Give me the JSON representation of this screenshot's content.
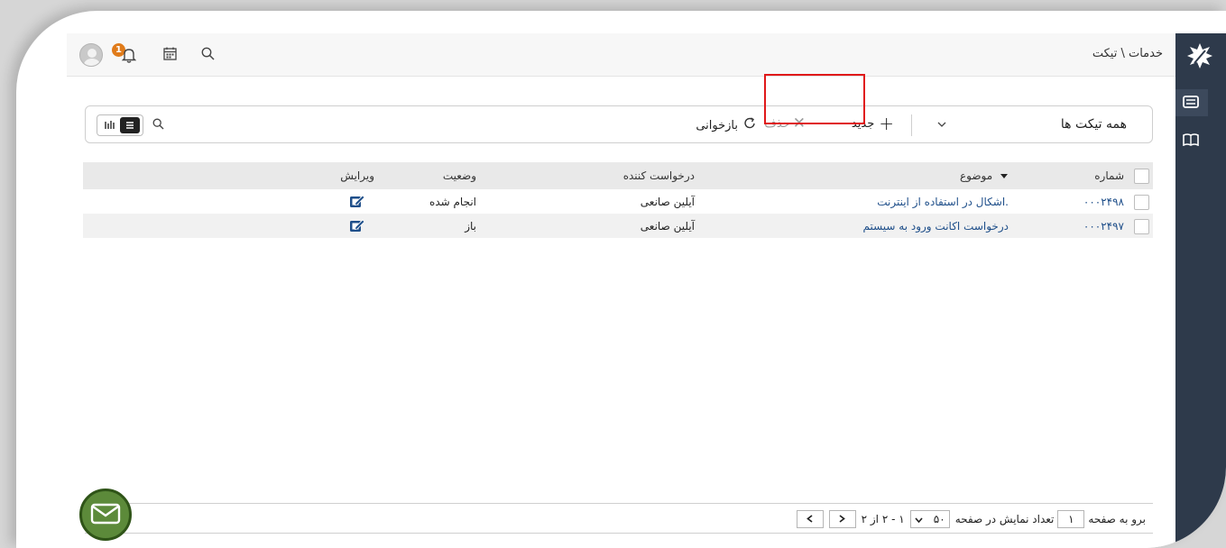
{
  "breadcrumb": "خدمات \\ تیکت",
  "notifications": {
    "count": "1"
  },
  "toolbar": {
    "filter": "همه تیکت ها",
    "new_label": "جدید",
    "delete_label": "حذف",
    "refresh_label": "بازخوانی"
  },
  "grid": {
    "columns": {
      "number": "شماره",
      "subject": "موضوع",
      "requester": "درخواست کننده",
      "status": "وضعیت",
      "edit": "ویرایش"
    },
    "rows": [
      {
        "number": "۰۰۰۲۴۹۸",
        "subject": ".اشکال در استفاده از اینترنت",
        "requester": "آیلین صانعی",
        "status": "انجام شده"
      },
      {
        "number": "۰۰۰۲۴۹۷",
        "subject": "درخواست اکانت ورود به سیستم",
        "requester": "آیلین صانعی",
        "status": "باز"
      }
    ]
  },
  "pager": {
    "goto_label": "برو به صفحه",
    "page_value": "۱",
    "per_page_label": "تعداد نمایش در صفحه",
    "per_page_value": "۵۰",
    "range_text": "۱ - ۲ از ۲"
  },
  "colors": {
    "rail": "#2e3a4b",
    "link": "#1f4f8a",
    "highlight": "#e0191a",
    "badge": "#e07b1a",
    "fab": "#5c8a3a"
  }
}
